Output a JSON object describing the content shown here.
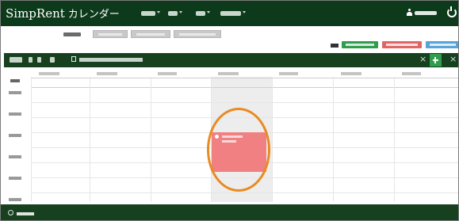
{
  "app": {
    "brand": "SimpRent",
    "title": "カレンダー",
    "caret": "▾"
  },
  "toolbar": {
    "close_symbol": "×"
  },
  "legend": {
    "colors": [
      "#2f9d4b",
      "#e26565",
      "#58a3d8"
    ]
  },
  "icons": [
    "user-icon",
    "power-icon",
    "calendar-icon",
    "plus-icon",
    "close-icon",
    "info-icon",
    "event-status-icon"
  ],
  "colors": {
    "nav": "#0e3a1c",
    "toolbar": "#17401f",
    "event": "#f08081",
    "annotation": "#ea8a22"
  }
}
